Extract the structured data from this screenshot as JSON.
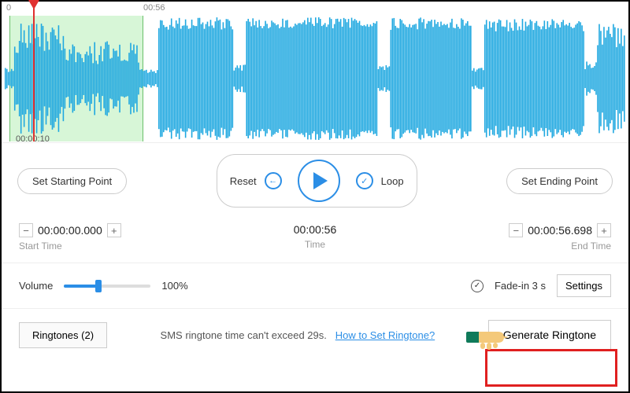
{
  "ruler": {
    "left_mark": "0",
    "time_mark": "00:56"
  },
  "playhead_time": "00:00:10",
  "buttons": {
    "set_start": "Set Starting Point",
    "set_end": "Set Ending Point",
    "reset": "Reset",
    "loop": "Loop"
  },
  "times": {
    "start": {
      "value": "00:00:00.000",
      "label": "Start Time"
    },
    "total": {
      "value": "00:00:56",
      "label": "Time"
    },
    "end": {
      "value": "00:00:56.698",
      "label": "End Time"
    }
  },
  "volume": {
    "label": "Volume",
    "percent": "100%"
  },
  "fade": {
    "label": "Fade-in 3 s"
  },
  "settings_label": "Settings",
  "bottom": {
    "ringtones": "Ringtones (2)",
    "hint": "SMS ringtone time can't exceed 29s.",
    "link": "How to Set Ringtone?",
    "generate": "Generate Ringtone"
  },
  "colors": {
    "accent": "#2b8ee6",
    "waveform": "#1fa8e0",
    "highlight": "#e02020"
  }
}
